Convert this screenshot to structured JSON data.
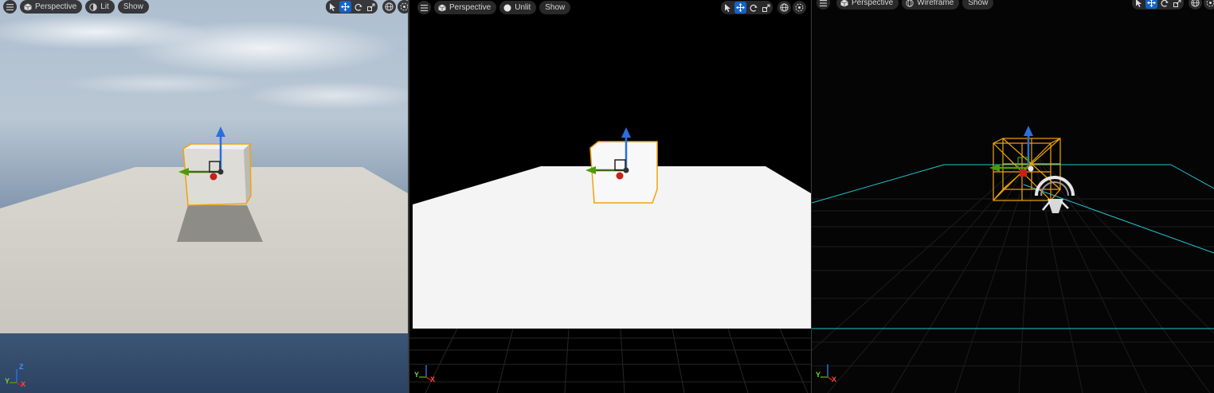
{
  "viewports": [
    {
      "id": "lit",
      "view_type": "Perspective",
      "view_mode": "Lit",
      "view_mode_icon": "lit-circle-icon",
      "show_label": "Show"
    },
    {
      "id": "unlit",
      "view_type": "Perspective",
      "view_mode": "Unlit",
      "view_mode_icon": "unlit-circle-icon",
      "show_label": "Show"
    },
    {
      "id": "wireframe",
      "view_type": "Perspective",
      "view_mode": "Wireframe",
      "view_mode_icon": "wireframe-globe-icon",
      "show_label": "Show"
    }
  ],
  "transform_tools": [
    "select-tool-icon",
    "translate-tool-icon",
    "rotate-tool-icon",
    "scale-tool-icon"
  ],
  "active_tool": "translate-tool-icon",
  "axis_labels": {
    "x": "X",
    "y": "Y",
    "z": "Z"
  },
  "colors": {
    "accent_active": "#1463c7",
    "selection_outline": "#f0a30a",
    "gizmo_x": "#c8201a",
    "gizmo_y": "#4e9a06",
    "gizmo_z": "#2b6fdc",
    "wire_grid": "#1fc7cf"
  }
}
